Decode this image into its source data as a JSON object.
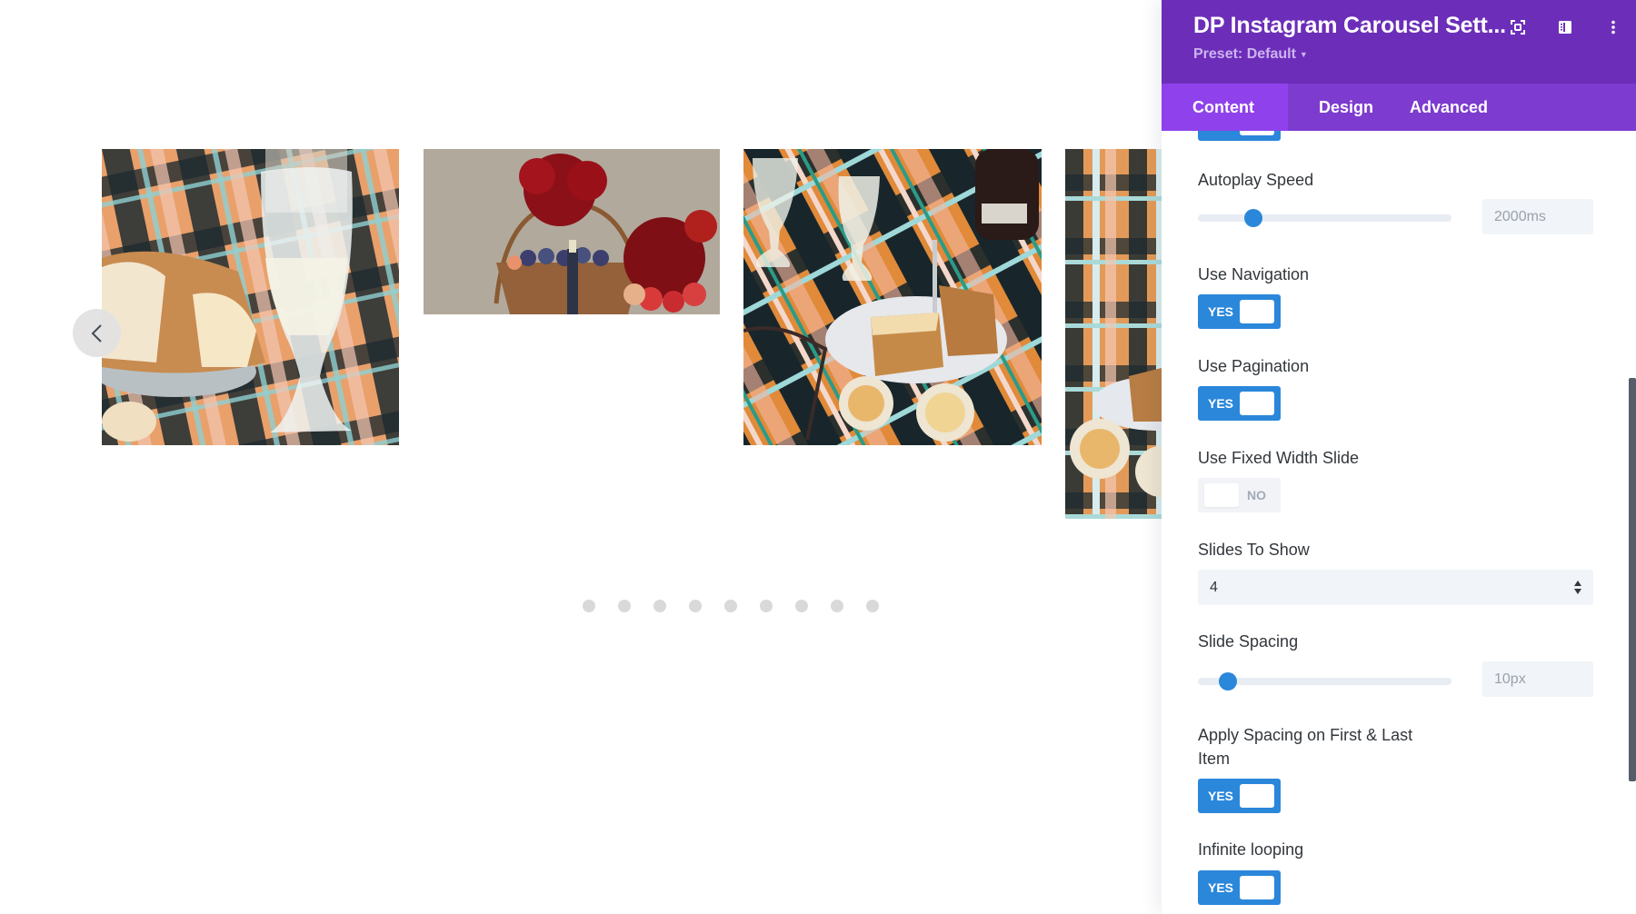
{
  "carousel": {
    "slides": [
      {
        "alt": "Crystal glass with white wine and bread on plaid picnic blanket"
      },
      {
        "alt": "Wicker basket with plums, red chrysanthemums and apples on grass"
      },
      {
        "alt": "Picnic blanket with glasses, cake slice on plate, fork and egg tarts"
      },
      {
        "alt": "Plaid blanket with plate of cake and egg tarts (partially visible)"
      }
    ],
    "prev_icon": "chevron-left-icon",
    "pagination": {
      "count": 9,
      "active_index": null
    }
  },
  "panel": {
    "title": "DP Instagram Carousel Sett...",
    "preset": "Preset: Default",
    "header_icons": [
      "expand-icon",
      "layout-sidebar-icon",
      "more-vertical-icon"
    ],
    "tabs": [
      {
        "label": "Content",
        "active": true
      },
      {
        "label": "Design",
        "active": false
      },
      {
        "label": "Advanced",
        "active": false
      }
    ],
    "colors": {
      "header": "#6c2eb9",
      "tab_bar": "#7d3bcf",
      "tab_active": "#8f42ec",
      "toggle_on": "#2b87da",
      "slider_thumb": "#2b87da"
    },
    "settings": {
      "autoplay_speed": {
        "label": "Autoplay Speed",
        "value": "2000ms",
        "slider_fraction": 0.22
      },
      "use_navigation": {
        "label": "Use Navigation",
        "state": "YES"
      },
      "use_pagination": {
        "label": "Use Pagination",
        "state": "YES"
      },
      "use_fixed_width_slide": {
        "label": "Use Fixed Width Slide",
        "state": "NO"
      },
      "slides_to_show": {
        "label": "Slides To Show",
        "value": "4"
      },
      "slide_spacing": {
        "label": "Slide Spacing",
        "value": "10px",
        "slider_fraction": 0.12
      },
      "apply_spacing_first_last": {
        "label_line1": "Apply Spacing on First & Last",
        "label_line2": "Item",
        "state": "YES"
      },
      "infinite_looping": {
        "label": "Infinite looping",
        "state": "YES"
      },
      "partial_toggle_above": {
        "state": "YES"
      }
    }
  }
}
